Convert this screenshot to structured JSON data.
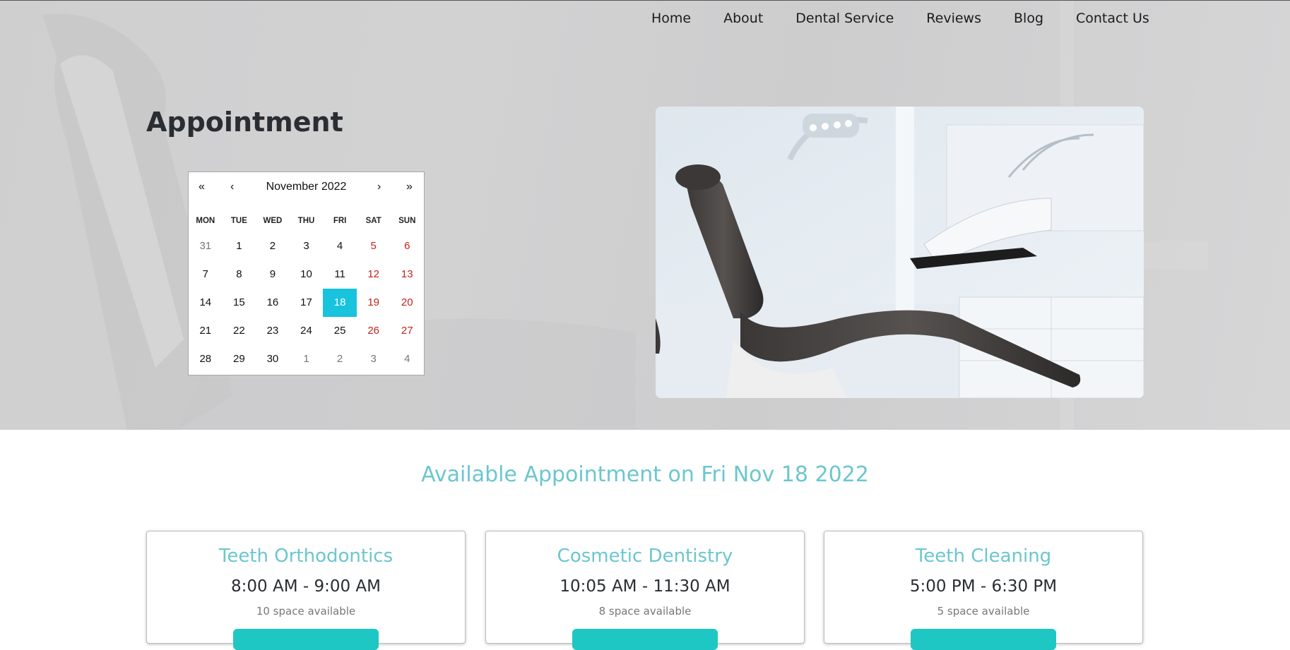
{
  "nav": {
    "items": [
      "Home",
      "About",
      "Dental Service",
      "Reviews",
      "Blog",
      "Contact Us"
    ]
  },
  "hero": {
    "title": "Appointment"
  },
  "calendar": {
    "prev_year": "«",
    "prev_month": "‹",
    "month_label": "November 2022",
    "next_month": "›",
    "next_year": "»",
    "weekdays": [
      "MON",
      "TUE",
      "WED",
      "THU",
      "FRI",
      "SAT",
      "SUN"
    ],
    "weeks": [
      [
        "31",
        "1",
        "2",
        "3",
        "4",
        "5",
        "6"
      ],
      [
        "7",
        "8",
        "9",
        "10",
        "11",
        "12",
        "13"
      ],
      [
        "14",
        "15",
        "16",
        "17",
        "18",
        "19",
        "20"
      ],
      [
        "21",
        "22",
        "23",
        "24",
        "25",
        "26",
        "27"
      ],
      [
        "28",
        "29",
        "30",
        "1",
        "2",
        "3",
        "4"
      ]
    ],
    "selected_day": "18",
    "colors": {
      "selected_bg": "#17c3dd",
      "weekend": "#c2241b",
      "muted": "#777777"
    }
  },
  "appointments": {
    "title": "Available Appointment on Fri Nov 18 2022",
    "cards": [
      {
        "title": "Teeth Orthodontics",
        "time": "8:00 AM - 9:00 AM",
        "space": "10 space available"
      },
      {
        "title": "Cosmetic Dentistry",
        "time": "10:05 AM - 11:30 AM",
        "space": "8 space available"
      },
      {
        "title": "Teeth Cleaning",
        "time": "5:00 PM - 6:30 PM",
        "space": "5 space available"
      }
    ]
  },
  "colors": {
    "accent": "#6cc6cf",
    "button": "#1ec7c4"
  }
}
